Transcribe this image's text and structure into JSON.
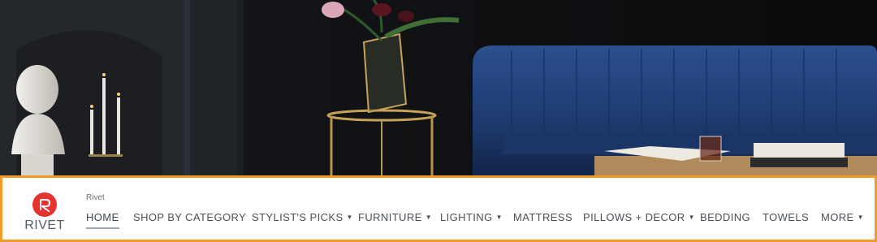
{
  "store": {
    "logo_text": "RIVET",
    "name": "Rivet",
    "accent_color": "#e8322f",
    "frame_color": "#f39a2b"
  },
  "nav": {
    "items": [
      {
        "label": "HOME",
        "active": true,
        "has_dropdown": false
      },
      {
        "label": "SHOP BY CATEGORY",
        "active": false,
        "has_dropdown": false
      },
      {
        "label": "STYLIST'S PICKS",
        "active": false,
        "has_dropdown": true
      },
      {
        "label": "FURNITURE",
        "active": false,
        "has_dropdown": true
      },
      {
        "label": "LIGHTING",
        "active": false,
        "has_dropdown": true
      },
      {
        "label": "MATTRESS",
        "active": false,
        "has_dropdown": false
      },
      {
        "label": "PILLOWS + DECOR",
        "active": false,
        "has_dropdown": true
      },
      {
        "label": "BEDDING",
        "active": false,
        "has_dropdown": false
      },
      {
        "label": "TOWELS",
        "active": false,
        "has_dropdown": false
      },
      {
        "label": "MORE",
        "active": false,
        "has_dropdown": true
      }
    ],
    "dropdown_icon": "caret-down-icon"
  }
}
